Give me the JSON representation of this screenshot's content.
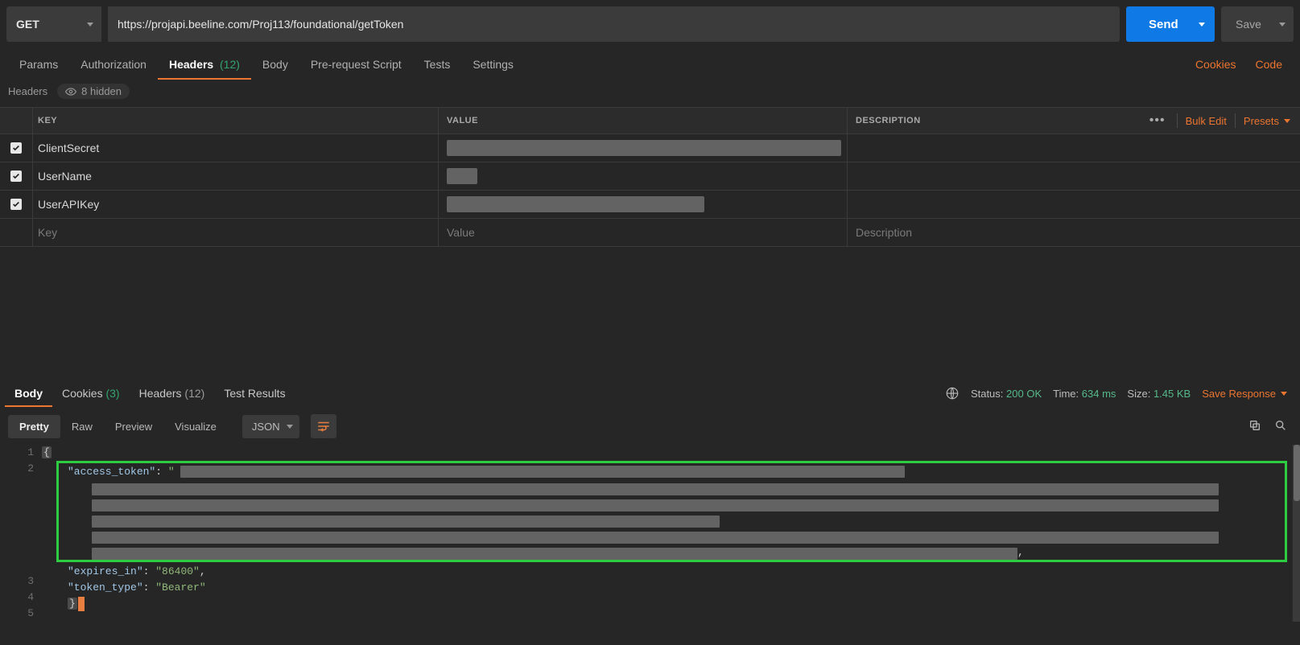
{
  "request": {
    "method": "GET",
    "url": "https://projapi.beeline.com/Proj113/foundational/getToken",
    "send_label": "Send",
    "save_label": "Save"
  },
  "req_tabs": {
    "params": "Params",
    "authorization": "Authorization",
    "headers": "Headers",
    "headers_count": "(12)",
    "body": "Body",
    "prerequest": "Pre-request Script",
    "tests": "Tests",
    "settings": "Settings",
    "cookies_link": "Cookies",
    "code_link": "Code"
  },
  "hidden_row": {
    "label": "Headers",
    "hidden_text": "8 hidden"
  },
  "table": {
    "col_key": "KEY",
    "col_value": "VALUE",
    "col_desc": "DESCRIPTION",
    "bulk_edit": "Bulk Edit",
    "presets": "Presets",
    "rows": [
      {
        "key": "ClientSecret",
        "value_redacted_width": 490
      },
      {
        "key": "UserName",
        "value_redacted_width": 38
      },
      {
        "key": "UserAPIKey",
        "value_redacted_width": 320
      }
    ],
    "placeholder_key": "Key",
    "placeholder_value": "Value",
    "placeholder_desc": "Description"
  },
  "res_tabs": {
    "body": "Body",
    "cookies": "Cookies",
    "cookies_count": "(3)",
    "headers": "Headers",
    "headers_count": "(12)",
    "test_results": "Test Results"
  },
  "res_meta": {
    "status_label": "Status:",
    "status_value": "200 OK",
    "time_label": "Time:",
    "time_value": "634 ms",
    "size_label": "Size:",
    "size_value": "1.45 KB",
    "save_response": "Save Response"
  },
  "res_toolbar": {
    "pretty": "Pretty",
    "raw": "Raw",
    "preview": "Preview",
    "visualize": "Visualize",
    "format": "JSON"
  },
  "response_json": {
    "line_numbers": [
      "1",
      "2",
      "3",
      "4",
      "5"
    ],
    "fields": {
      "access_token_key": "\"access_token\"",
      "expires_in_key": "\"expires_in\"",
      "expires_in_value": "\"86400\"",
      "token_type_key": "\"token_type\"",
      "token_type_value": "\"Bearer\""
    }
  }
}
